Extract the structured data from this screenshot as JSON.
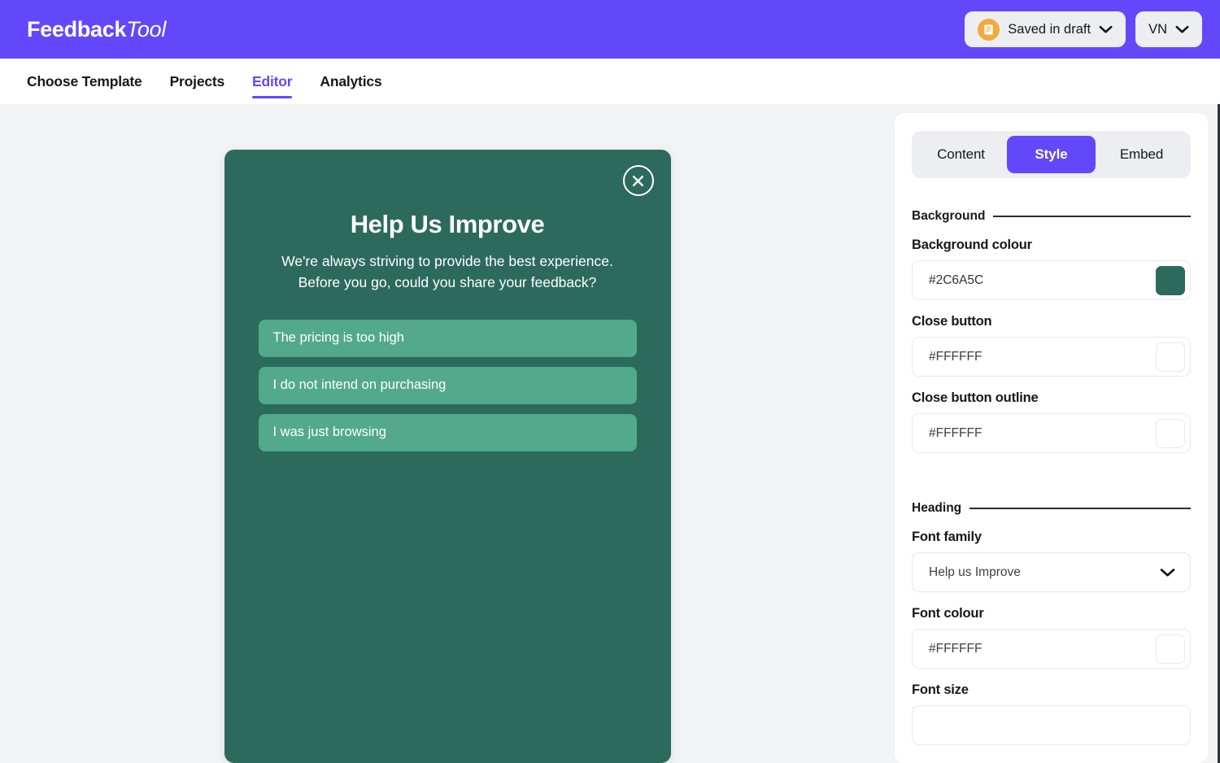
{
  "brand": {
    "name_bold": "Feedback",
    "name_italic": "Tool",
    "purple": "#6347FA"
  },
  "topbar": {
    "draft_status": {
      "label": "Saved in draft",
      "icon": "document-note-icon",
      "icon_bg": "#F4A93C",
      "chevron": "chevron-down-icon"
    },
    "language": {
      "label": "VN",
      "chevron": "chevron-down-icon"
    }
  },
  "nav": {
    "items": [
      {
        "label": "Choose Template",
        "active": false
      },
      {
        "label": "Projects",
        "active": false
      },
      {
        "label": "Editor",
        "active": true
      },
      {
        "label": "Analytics",
        "active": false
      }
    ]
  },
  "preview": {
    "background_colour": "#2C6A5C",
    "option_colour": "#52A98C",
    "close_icon": "close-circle-icon",
    "title": "Help Us Improve",
    "subtitle_line1": "We're always striving to provide the best experience.",
    "subtitle_line2": "Before you go, could you share your feedback?",
    "options": [
      "The pricing is too high",
      "I do not intend on purchasing",
      "I was just browsing"
    ]
  },
  "panel": {
    "tabs": [
      {
        "label": "Content",
        "active": false
      },
      {
        "label": "Style",
        "active": true
      },
      {
        "label": "Embed",
        "active": false
      }
    ],
    "sections": [
      {
        "title": "Background",
        "fields": [
          {
            "label": "Background colour",
            "type": "colour",
            "value": "#2C6A5C",
            "swatch": "#2C6A5C"
          },
          {
            "label": "Close button",
            "type": "colour",
            "value": "#FFFFFF",
            "swatch": "#FFFFFF"
          },
          {
            "label": "Close button outline",
            "type": "colour",
            "value": "#FFFFFF",
            "swatch": "#FFFFFF"
          }
        ]
      },
      {
        "title": "Heading",
        "fields": [
          {
            "label": "Font family",
            "type": "select",
            "value": "Help us Improve",
            "chevron": "chevron-down-icon"
          },
          {
            "label": "Font colour",
            "type": "colour",
            "value": "#FFFFFF",
            "swatch": "#FFFFFF"
          },
          {
            "label": "Font size",
            "type": "text",
            "value": ""
          }
        ]
      }
    ]
  }
}
